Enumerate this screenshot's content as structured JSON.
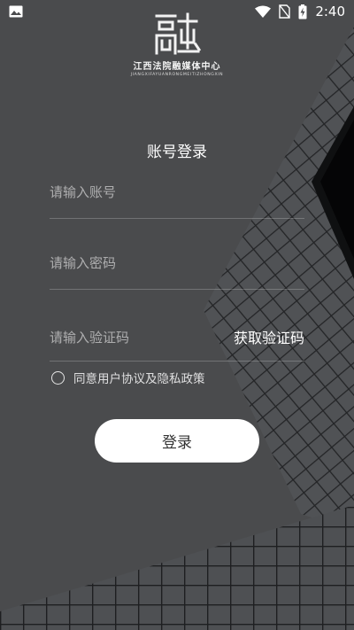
{
  "status_bar": {
    "time": "2:40",
    "icons": [
      "image-icon",
      "wifi-icon",
      "no-sim-icon",
      "battery-charging-icon"
    ]
  },
  "logo": {
    "title": "江西法院融媒体中心",
    "subtitle": "JIANGXIFAYUANRONGMEITIZHONGXIN"
  },
  "login": {
    "title": "账号登录",
    "account_placeholder": "请输入账号",
    "password_placeholder": "请输入密码",
    "code_placeholder": "请输入验证码",
    "get_code_label": "获取验证码",
    "agreement_text": "同意用户协议及隐私政策",
    "submit_label": "登录"
  },
  "colors": {
    "background": "#4a4b4d",
    "text": "#ffffff",
    "button_bg": "#ffffff",
    "button_text": "#333333"
  }
}
